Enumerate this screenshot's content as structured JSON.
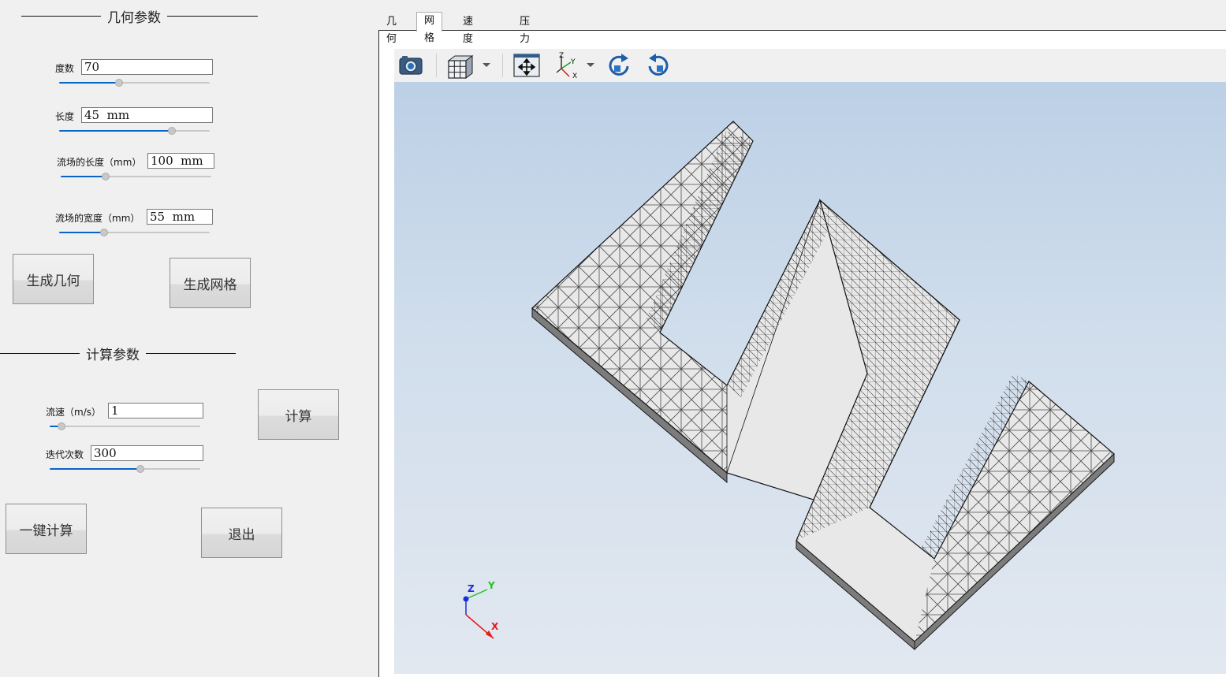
{
  "geometry_group": {
    "title": "几何参数",
    "params": [
      {
        "label": "度数",
        "value": "70",
        "slider": 0.4
      },
      {
        "label": "长度",
        "value": "45  mm",
        "slider": 0.75
      },
      {
        "label": "流场的长度（mm）",
        "value": "100  mm",
        "slider": 0.3
      },
      {
        "label": "流场的宽度（mm）",
        "value": "55  mm",
        "slider": 0.3
      }
    ],
    "generate_geometry_button": "生成几何",
    "generate_mesh_button": "生成网格"
  },
  "compute_group": {
    "title": "计算参数",
    "params": [
      {
        "label": "流速（m/s）",
        "value": "1",
        "slider": 0.08
      },
      {
        "label": "迭代次数",
        "value": "300",
        "slider": 0.6
      }
    ],
    "compute_button": "计算",
    "one_click_button": "一键计算",
    "exit_button": "退出"
  },
  "tabs": [
    {
      "label": "几何",
      "active": false
    },
    {
      "label": "网格",
      "active": true
    },
    {
      "label": "速度云图",
      "active": false
    },
    {
      "label": "压力云图",
      "active": false
    }
  ],
  "toolbar": {
    "icons": [
      "camera-icon",
      "mesh-view-icon",
      "fit-view-icon",
      "axes-orientation-icon",
      "rotate-clockwise-icon",
      "rotate-counterclockwise-icon"
    ]
  },
  "axis_triad": {
    "x": "X",
    "y": "Y",
    "z": "Z"
  },
  "colors": {
    "accent": "#0a64c8",
    "viewport_top": "#bcd0e6",
    "viewport_bottom": "#e2e8f0",
    "mesh_face": "#e8e8e8",
    "axis_x": "#e8191b",
    "axis_y": "#22c122",
    "axis_z": "#1a2ed8"
  }
}
